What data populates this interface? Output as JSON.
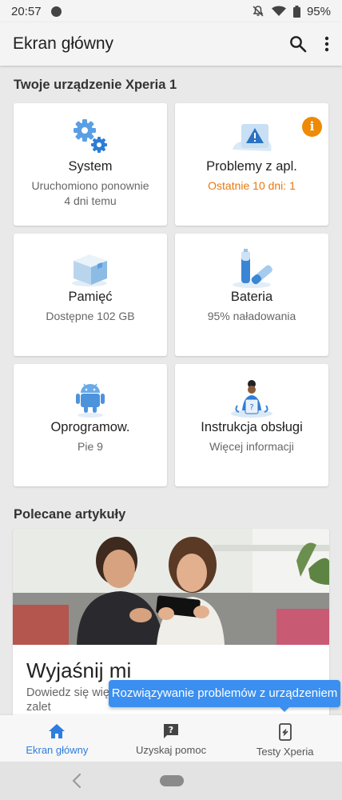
{
  "status_bar": {
    "time": "20:57",
    "battery": "95%"
  },
  "app_bar": {
    "title": "Ekran główny",
    "search_icon": "search-icon",
    "menu_icon": "more-vert-icon"
  },
  "device_section": {
    "title": "Twoje urządzenie Xperia 1",
    "cards": [
      {
        "title": "System",
        "subtitle": "Uruchomiono ponownie 4 dni temu",
        "icon": "gears-icon"
      },
      {
        "title": "Problemy z apl.",
        "subtitle": "Ostatnie 10 dni: 1",
        "icon": "warning-icon",
        "badge": "i"
      },
      {
        "title": "Pamięć",
        "subtitle": "Dostępne 102 GB",
        "icon": "storage-box-icon"
      },
      {
        "title": "Bateria",
        "subtitle": "95% naładowania",
        "icon": "battery-icon"
      },
      {
        "title": "Oprogramow.",
        "subtitle": "Pie 9",
        "icon": "android-icon"
      },
      {
        "title": "Instrukcja obsługi",
        "subtitle": "Więcej informacji",
        "icon": "manual-icon"
      }
    ]
  },
  "articles": {
    "title": "Polecane artykuły",
    "featured": {
      "title": "Wyjaśnij mi",
      "description": "Dowiedz się wię zalet"
    }
  },
  "tooltip": {
    "text": "Rozwiązywanie problemów z urządzeniem"
  },
  "bottom_nav": [
    {
      "label": "Ekran główny",
      "icon": "home-icon",
      "active": true
    },
    {
      "label": "Uzyskaj pomoc",
      "icon": "help-chat-icon",
      "active": false
    },
    {
      "label": "Testy Xperia",
      "icon": "phone-test-icon",
      "active": false
    }
  ],
  "colors": {
    "accent": "#2f7ddd",
    "alert": "#e8780e",
    "badge": "#ee8a06",
    "tooltip": "#3a8ff0"
  }
}
